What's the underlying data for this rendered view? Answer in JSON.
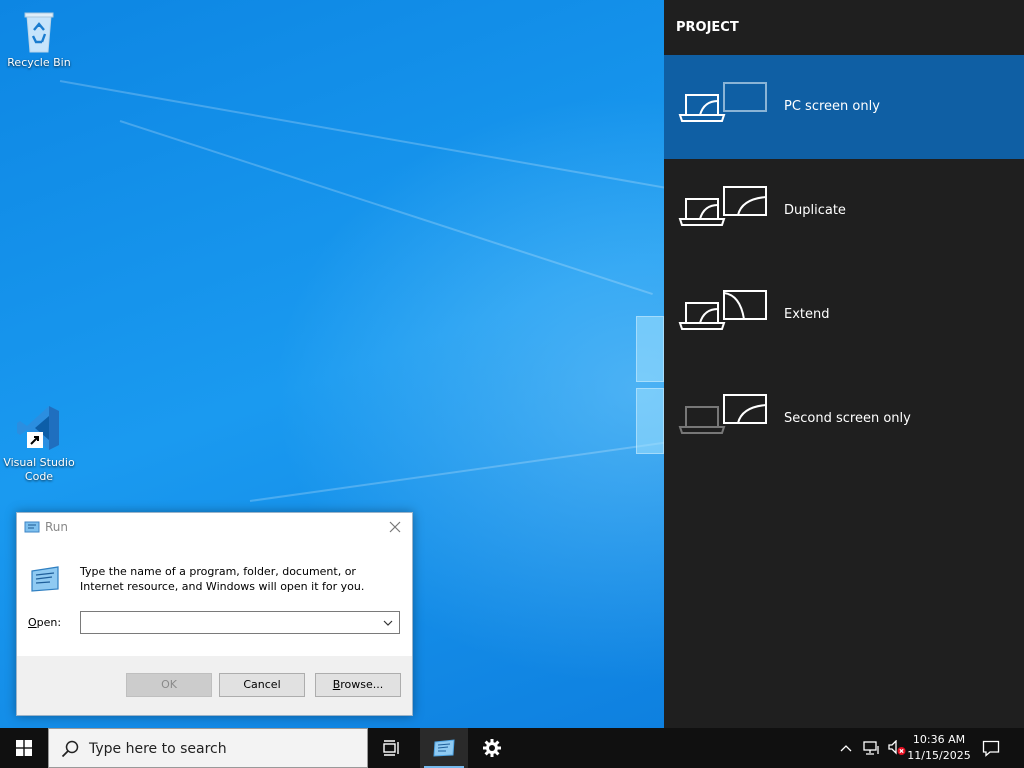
{
  "desktop": {
    "icons": [
      {
        "label": "Recycle Bin",
        "icon": "recycle-bin-icon"
      },
      {
        "label_line1": "Visual Studio",
        "label_line2": "Code",
        "icon": "vscode-icon"
      }
    ]
  },
  "run_dialog": {
    "title": "Run",
    "description": "Type the name of a program, folder, document, or Internet resource, and Windows will open it for you.",
    "open_label_prefix": "",
    "open_label_underlined": "O",
    "open_label_rest": "pen:",
    "input_value": "",
    "ok_label": "OK",
    "cancel_label": "Cancel",
    "browse_label_underlined": "B",
    "browse_label_rest": "rowse..."
  },
  "project": {
    "title": "PROJECT",
    "options": [
      {
        "label": "PC screen only",
        "selected": true
      },
      {
        "label": "Duplicate",
        "selected": false
      },
      {
        "label": "Extend",
        "selected": false
      },
      {
        "label": "Second screen only",
        "selected": false
      }
    ]
  },
  "taskbar": {
    "search_placeholder": "Type here to search",
    "clock_time": "10:36 AM",
    "clock_date": "11/15/2025"
  },
  "colors": {
    "accent": "#0f5fa4",
    "pane_bg": "#1f1f1f",
    "taskbar_bg": "#101010"
  }
}
